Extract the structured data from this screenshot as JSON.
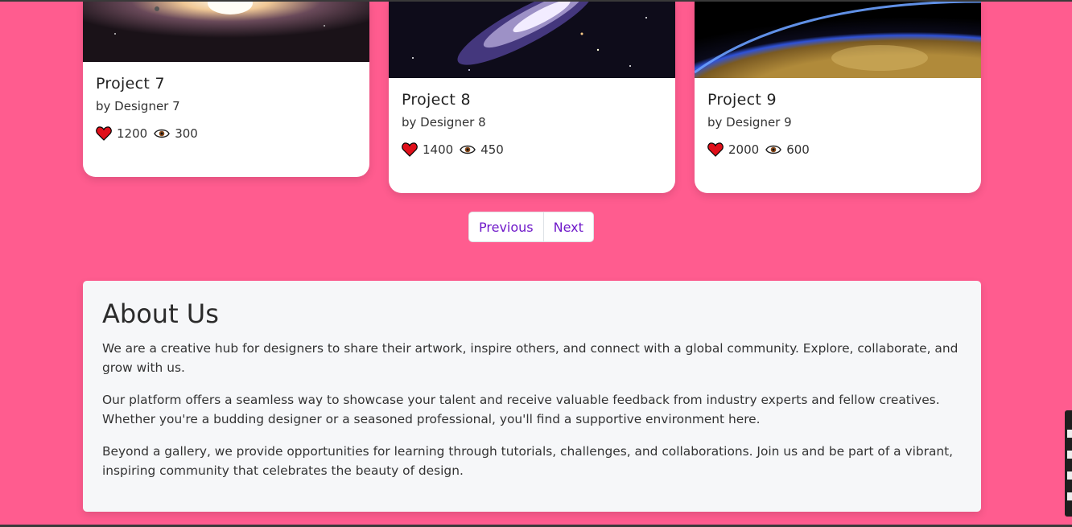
{
  "projects": [
    {
      "title": "Project 7",
      "designer": "by Designer 7",
      "likes": "1200",
      "views": "300"
    },
    {
      "title": "Project 8",
      "designer": "by Designer 8",
      "likes": "1400",
      "views": "450"
    },
    {
      "title": "Project 9",
      "designer": "by Designer 9",
      "likes": "2000",
      "views": "600"
    }
  ],
  "pagination": {
    "previous": "Previous",
    "next": "Next"
  },
  "about": {
    "title": "About Us",
    "paragraphs": [
      "We are a creative hub for designers to share their artwork, inspire others, and connect with a global community. Explore, collaborate, and grow with us.",
      "Our platform offers a seamless way to showcase your talent and receive valuable feedback from industry experts and fellow creatives. Whether you're a budding designer or a seasoned professional, you'll find a supportive environment here.",
      "Beyond a gallery, we provide opportunities for learning through tutorials, challenges, and collaborations. Join us and be part of a vibrant, inspiring community that celebrates the beauty of design."
    ]
  },
  "colors": {
    "background": "#ff5c8f",
    "link": "#6f18c9",
    "heart": "#e0101a"
  },
  "icons": {
    "likes": "heart-icon",
    "views": "eye-icon"
  }
}
